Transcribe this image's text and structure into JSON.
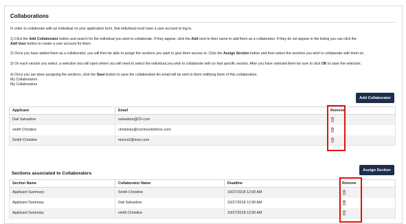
{
  "panel": {
    "title": "Collaborations"
  },
  "instructions": {
    "intro": "In order to collaborate with an individual on your application form, that individual must have a user account to log in.",
    "step1_a": "1) Click the ",
    "step1_b": "Add Collaborator",
    "step1_c": " button and search for the individual you wish to collaborate.  If they appear, click the ",
    "step1_d": "Add",
    "step1_e": " next to their name to add them as a collaborator.  If they do not appear in the listing you can click the",
    "step1_f": "Add User",
    "step1_g": " button to create a user account for them.",
    "step2_a": "2) Once you have added them as a collaborator, you will then be able to assign the sections you want to give them access to.  Click the ",
    "step2_b": "Assign Section",
    "step2_c": " button and then select the sections you wish to collaborate with them on.",
    "step3_a": "3) On each section you select, a selection box will open where you will need to select the individual you wish to collaborate with on that specific section.  After you have selected them be sure to click ",
    "step3_b": "OK",
    "step3_c": " to save the selection.",
    "step4_a": "4) Once you are done assigning the sections, click the ",
    "step4_b": "Save",
    "step4_c": " button to save the collaboration An email will be sent to them notifying them of this collaboration.",
    "extra_1": "My Collaborators",
    "extra_2": "My Collaborators"
  },
  "buttons": {
    "add_collaborator": "Add Collaborator",
    "assign_section": "Assign Section"
  },
  "collaborators_table": {
    "headers": {
      "applicant": "Applicant",
      "email": "Email",
      "remove": "Remove"
    },
    "rows": [
      {
        "applicant": "Dali Salvadore",
        "email": "salvadore@CF.com"
      },
      {
        "applicant": "smith Christine",
        "email": "christines@communityforce.com"
      },
      {
        "applicant": "Smith Christine",
        "email": "msncs2@msn.com"
      }
    ]
  },
  "sections": {
    "title": "Sections associated to Collaborators",
    "headers": {
      "section_name": "Section Name",
      "collaborator_name": "Collaborator Name",
      "deadline": "Deadline",
      "remove": "Remove"
    },
    "rows": [
      {
        "section_name": "Applicant Summary",
        "collaborator_name": "Smith Christine",
        "deadline": "10/27/2018 12:00 AM"
      },
      {
        "section_name": "Applicant Summary",
        "collaborator_name": "Dali Salvadore",
        "deadline": "10/27/2018 12:00 AM"
      },
      {
        "section_name": "Applicant Summary",
        "collaborator_name": "smith Christine",
        "deadline": "10/27/2018 12:00 AM"
      }
    ]
  },
  "colors": {
    "button_bg": "#1b2e4b",
    "highlight": "#e01010",
    "row_alt": "#f2f2f2"
  },
  "icons": {
    "remove": "trash-icon"
  }
}
